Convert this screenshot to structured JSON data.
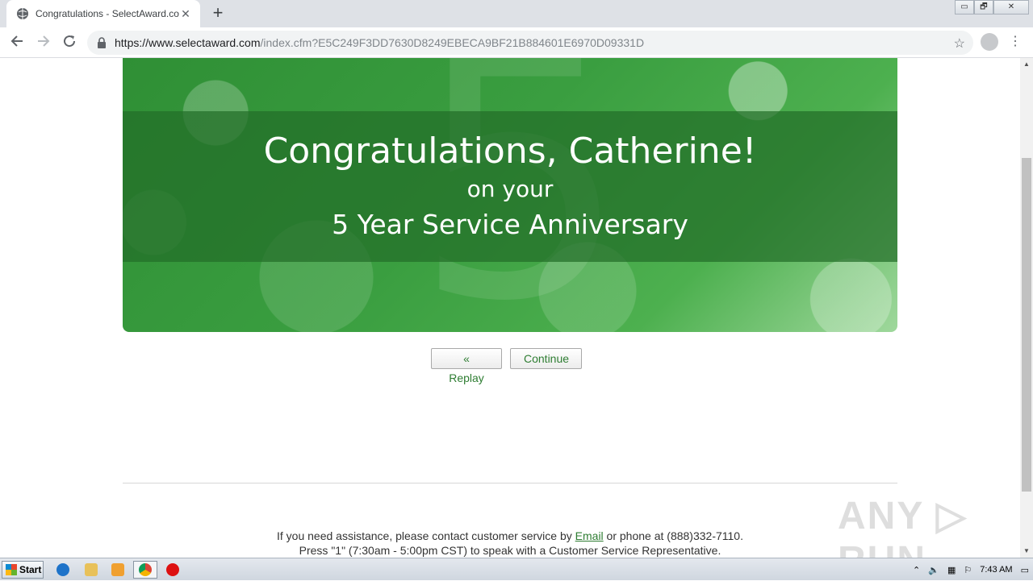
{
  "browser": {
    "tab_title": "Congratulations - SelectAward.com",
    "tab_close": "✕",
    "new_tab": "+",
    "url_domain": "https://www.selectaward.com",
    "url_path": "/index.cfm?E5C249F3DD7630D8249EBECA9BF21B884601E6970D09331D",
    "window_controls": {
      "minimize": "▭",
      "restore": "🗗",
      "close": "✕"
    }
  },
  "page": {
    "hero": {
      "big_number": "5",
      "headline": "Congratulations, Catherine!",
      "line2": "on your",
      "line3": "5 Year Service Anniversary"
    },
    "buttons": {
      "replay": "« Replay",
      "continue": "Continue"
    },
    "footer": {
      "line1_before": "If you need assistance, please contact customer service by ",
      "email_link": "Email",
      "line1_after": " or phone at (888)332-7110.",
      "line2": "Press \"1\" (7:30am - 5:00pm CST) to speak with a Customer Service Representative."
    }
  },
  "watermark": "ANY ▷ RUN",
  "taskbar": {
    "start_label": "Start",
    "clock": "7:43 AM"
  },
  "colors": {
    "accent_green": "#2e7d32",
    "hero_green": "#3a9e40"
  }
}
